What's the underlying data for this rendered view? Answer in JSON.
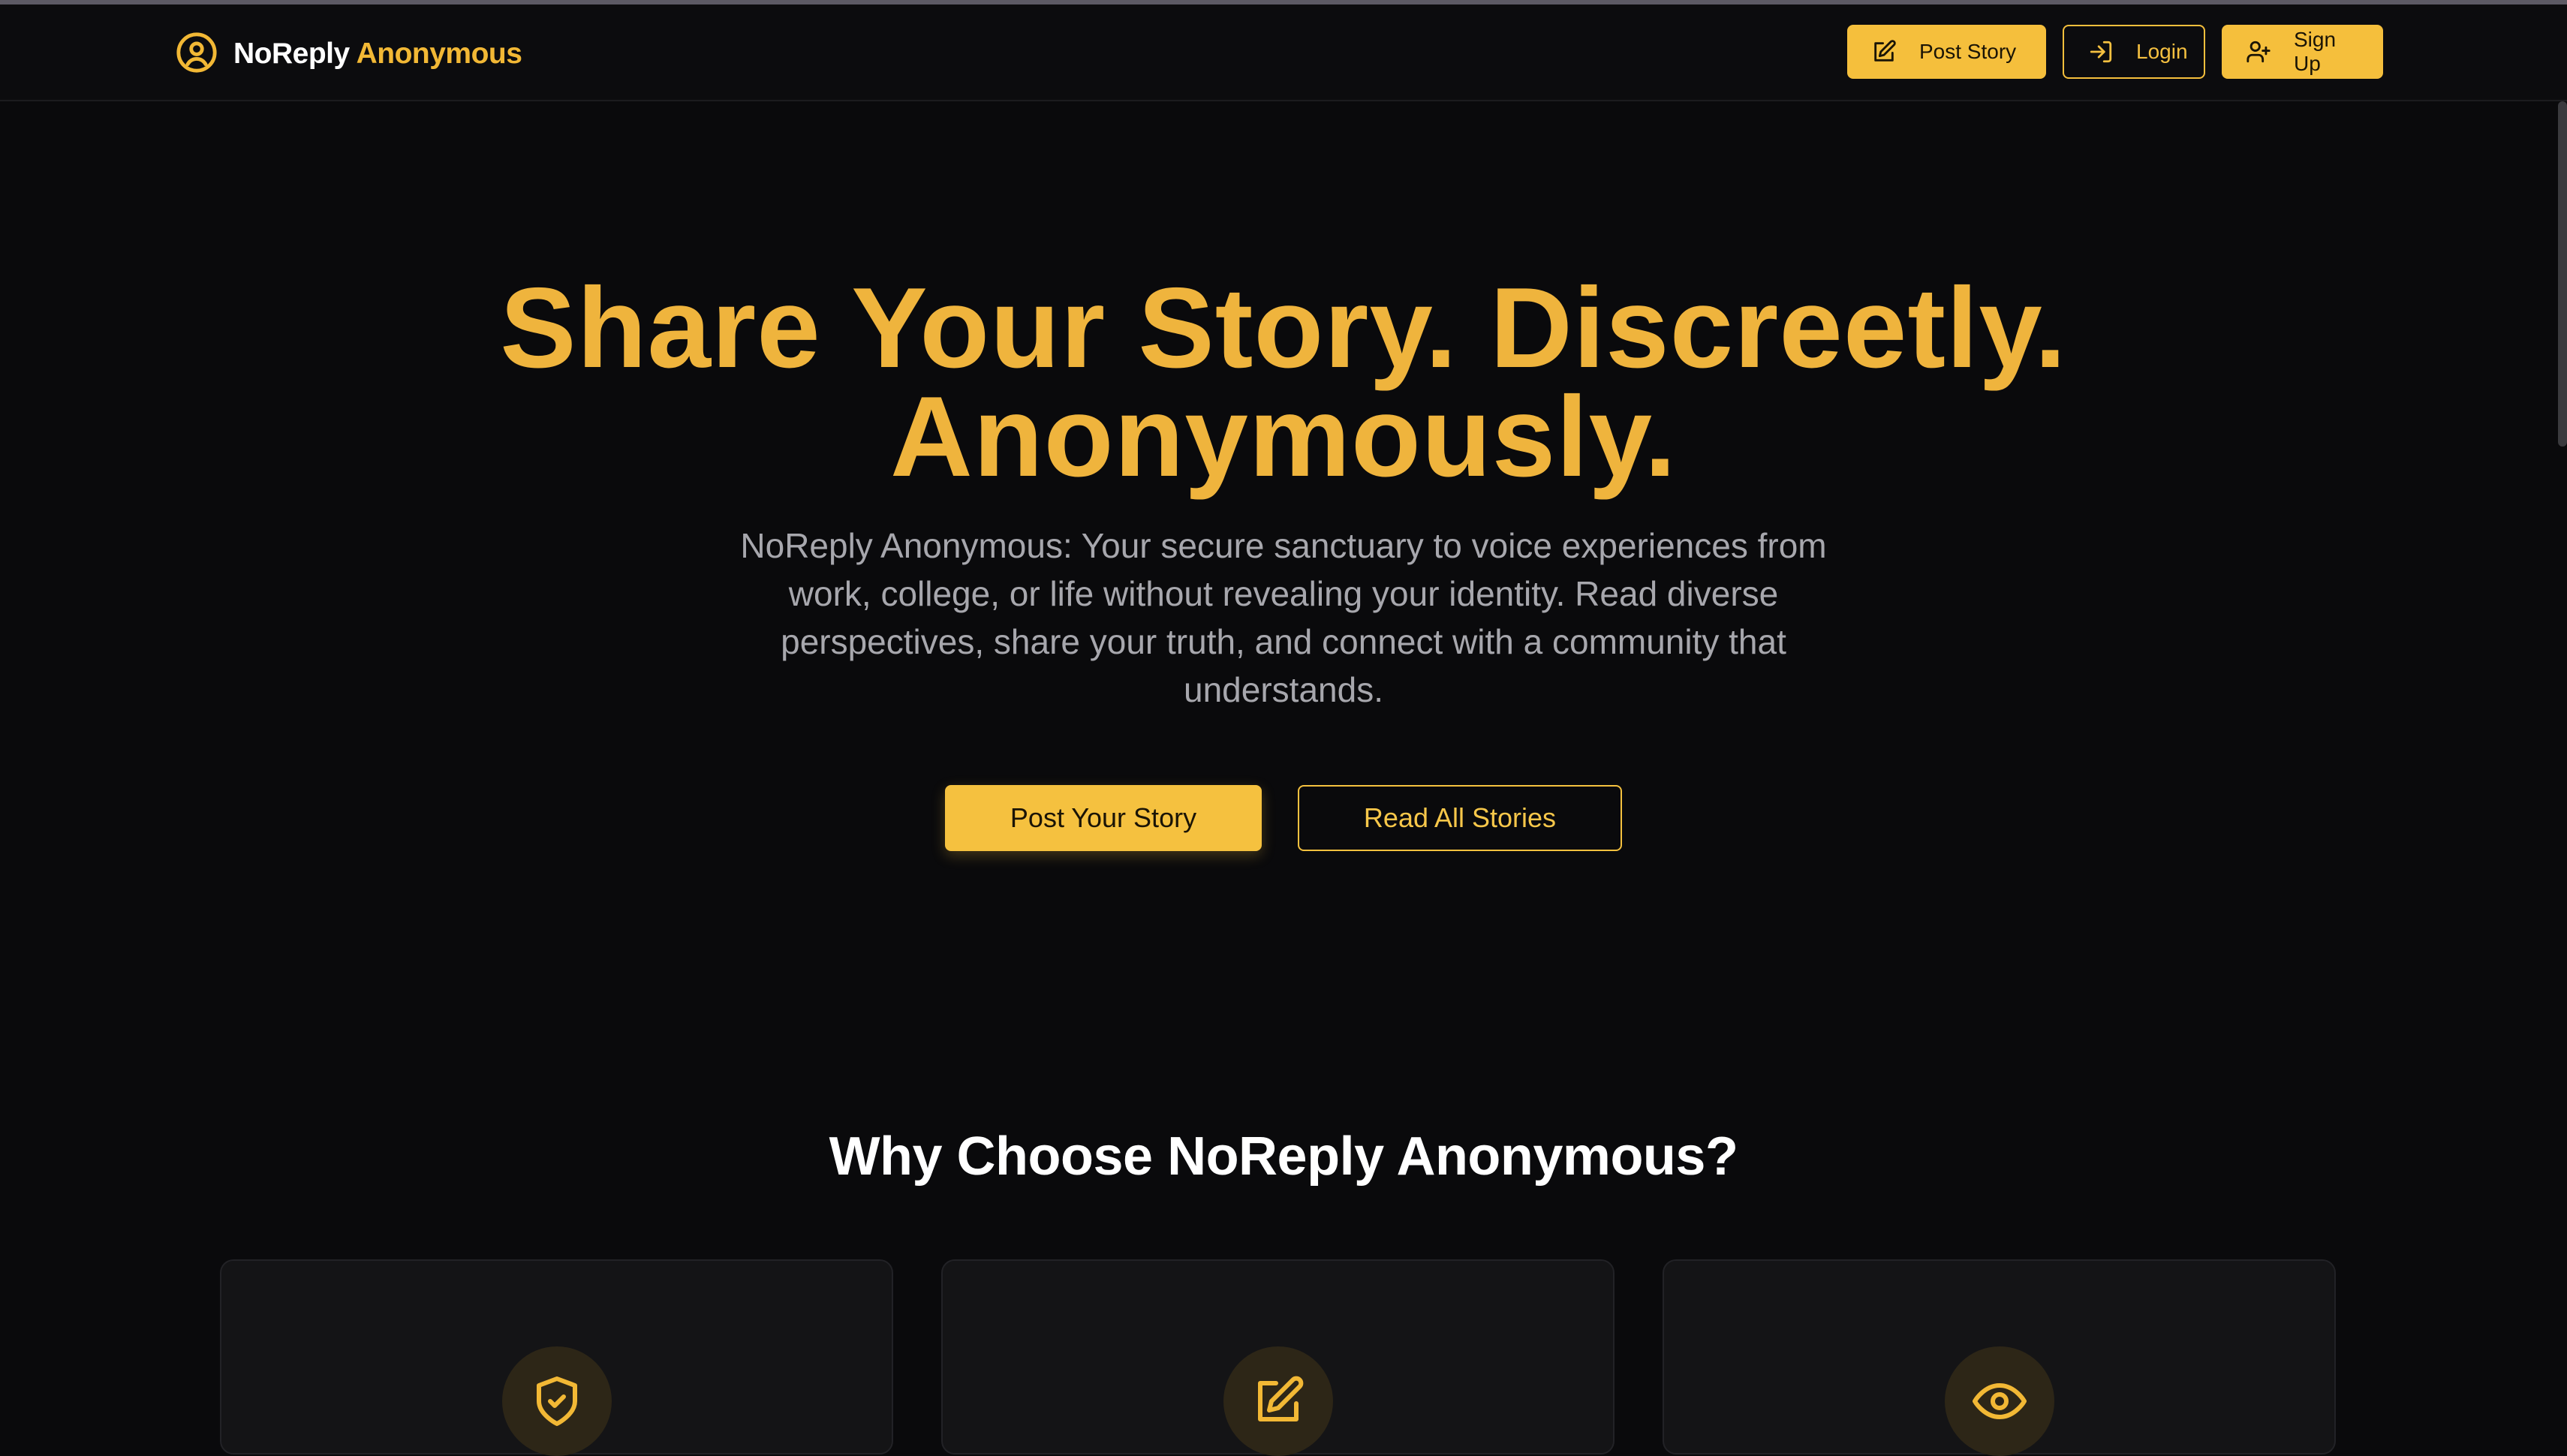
{
  "brand": {
    "name_part1": "NoReply",
    "name_part2": "Anonymous",
    "icon": "user-circle-icon"
  },
  "nav": {
    "post_story": {
      "label": "Post Story",
      "icon": "edit-icon"
    },
    "login": {
      "label": "Login",
      "icon": "login-icon"
    },
    "sign_up": {
      "label": "Sign Up",
      "icon": "user-plus-icon"
    }
  },
  "hero": {
    "title_line1": "Share Your Story. Discreetly.",
    "title_line2": "Anonymously.",
    "description": "NoReply Anonymous: Your secure sanctuary to voice experiences from work, college, or life without revealing your identity. Read diverse perspectives, share your truth, and connect with a community that understands.",
    "primary_button": "Post Your Story",
    "secondary_button": "Read All Stories"
  },
  "why": {
    "heading": "Why Choose NoReply Anonymous?"
  },
  "features": [
    {
      "icon": "shield-check-icon"
    },
    {
      "icon": "edit-icon"
    },
    {
      "icon": "eye-icon"
    }
  ],
  "colors": {
    "accent": "#f5bf3c",
    "background": "#0a0a0c",
    "headline": "#efb43d"
  }
}
